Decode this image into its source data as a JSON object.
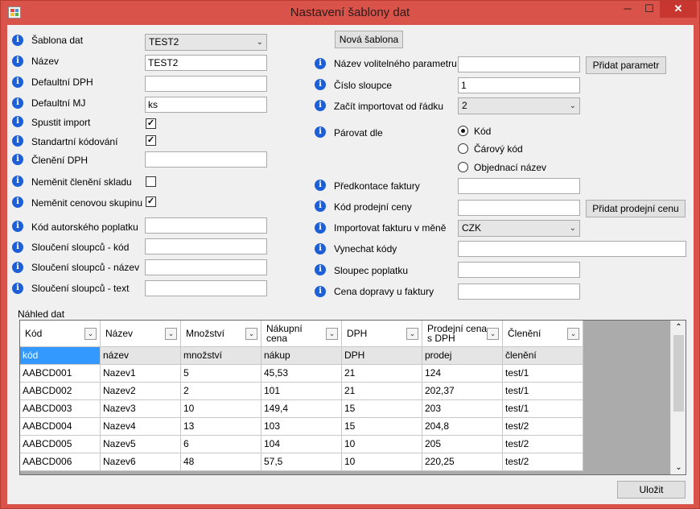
{
  "window": {
    "title": "Nastavení šablony dat",
    "min_glyph": "─",
    "max_glyph": "☐",
    "close_glyph": "✕"
  },
  "left_form": {
    "sablona_label": "Šablona dat",
    "sablona_value": "TEST2",
    "nazev_label": "Název",
    "nazev_value": "TEST2",
    "dph_label": "Defaultní DPH",
    "dph_value": "",
    "mj_label": "Defaultní MJ",
    "mj_value": "ks",
    "spustit_label": "Spustit import",
    "spustit_checked": "✓",
    "standard_label": "Standartní kódování",
    "standard_checked": "✓",
    "cleneni_label": "Členění DPH",
    "cleneni_value": "",
    "nemenit_skladu_label": "Neměnit členění skladu",
    "nemenit_skladu_checked": "",
    "nemenit_cenovou_label": "Neměnit cenovou skupinu",
    "nemenit_cenovou_checked": "✓",
    "kod_autorskeho_label": "Kód autorského poplatku",
    "kod_autorskeho_value": "",
    "slouceni_kod_label": "Sloučení sloupců - kód",
    "slouceni_kod_value": "",
    "slouceni_nazev_label": "Sloučení sloupců - název",
    "slouceni_nazev_value": "",
    "slouceni_text_label": "Sloučení sloupců - text",
    "slouceni_text_value": ""
  },
  "right_form": {
    "nova_sablona": "Nová šablona",
    "volitelny_label": "Název volitelného parametru",
    "volitelny_value": "",
    "pridat_parametr": "Přidat parametr",
    "cislo_label": "Číslo sloupce",
    "cislo_value": "1",
    "zacit_label": "Začít importovat od řádku",
    "zacit_value": "2",
    "parovat_label": "Párovat dle",
    "radio_kod": "Kód",
    "radio_carovy": "Čárový kód",
    "radio_objednaci": "Objednací název",
    "predkontace_label": "Předkontace faktury",
    "predkontace_value": "",
    "kod_prodejni_label": "Kód prodejní ceny",
    "kod_prodejni_value": "",
    "pridat_prodejni": "Přidat prodejní cenu",
    "mena_label": "Importovat fakturu v měně",
    "mena_value": "CZK",
    "vynechat_label": "Vynechat kódy",
    "vynechat_value": "",
    "sloupec_label": "Sloupec poplatku",
    "sloupec_value": "",
    "cena_dopravy_label": "Cena dopravy u faktury",
    "cena_dopravy_value": ""
  },
  "preview": {
    "label": "Náhled dat",
    "columns": [
      "Kód",
      "Název",
      "Množství",
      "Nákupní\ncena",
      "DPH",
      "Prodejní cena\ns DPH",
      "Členění"
    ],
    "header_row": [
      "kód",
      "název",
      "množství",
      "nákup",
      "DPH",
      "prodej",
      "členění"
    ],
    "rows": [
      [
        "AABCD001",
        "Nazev1",
        "5",
        "45,53",
        "21",
        "124",
        "test/1"
      ],
      [
        "AABCD002",
        "Nazev2",
        "2",
        "101",
        "21",
        "202,37",
        "test/1"
      ],
      [
        "AABCD003",
        "Nazev3",
        "10",
        "149,4",
        "15",
        "203",
        "test/1"
      ],
      [
        "AABCD004",
        "Nazev4",
        "13",
        "103",
        "15",
        "204,8",
        "test/2"
      ],
      [
        "AABCD005",
        "Nazev5",
        "6",
        "104",
        "10",
        "205",
        "test/2"
      ],
      [
        "AABCD006",
        "Nazev6",
        "48",
        "57,5",
        "10",
        "220,25",
        "test/2"
      ]
    ]
  },
  "footer": {
    "ulozit": "Uložit"
  },
  "icons": {
    "info": "i",
    "dropdown": "⌄",
    "scroll_up": "⌃",
    "scroll_down": "⌄"
  },
  "colors": {
    "titlebar": "#d9534a",
    "info_icon": "#1d5fd6",
    "selection": "#3399ff"
  }
}
